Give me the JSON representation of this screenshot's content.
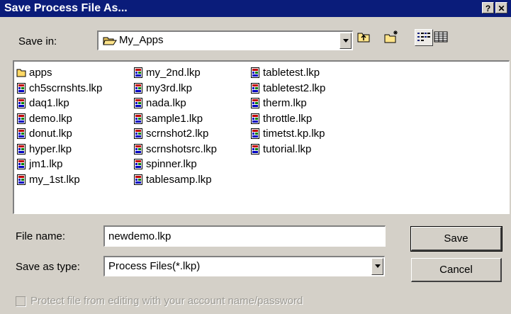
{
  "window": {
    "title": "Save Process File As...",
    "help_button": "?",
    "close_button": "✕"
  },
  "save_in": {
    "label": "Save in:",
    "value": "My_Apps",
    "folder_icon": "open-folder-icon"
  },
  "toolbar": {
    "buttons": [
      {
        "name": "up-one-level-icon"
      },
      {
        "name": "new-folder-icon"
      },
      {
        "name": "list-view-icon"
      },
      {
        "name": "details-view-icon"
      }
    ]
  },
  "files": {
    "columns": [
      [
        {
          "name": "apps",
          "icon": "folder-icon"
        },
        {
          "name": "ch5scrnshts.lkp",
          "icon": "file-icon"
        },
        {
          "name": "daq1.lkp",
          "icon": "file-icon"
        },
        {
          "name": "demo.lkp",
          "icon": "file-icon"
        },
        {
          "name": "donut.lkp",
          "icon": "file-icon"
        },
        {
          "name": "hyper.lkp",
          "icon": "file-icon"
        },
        {
          "name": "jm1.lkp",
          "icon": "file-icon"
        },
        {
          "name": "my_1st.lkp",
          "icon": "file-icon"
        }
      ],
      [
        {
          "name": "my_2nd.lkp",
          "icon": "file-icon"
        },
        {
          "name": "my3rd.lkp",
          "icon": "file-icon"
        },
        {
          "name": "nada.lkp",
          "icon": "file-icon"
        },
        {
          "name": "sample1.lkp",
          "icon": "file-icon"
        },
        {
          "name": "scrnshot2.lkp",
          "icon": "file-icon"
        },
        {
          "name": "scrnshotsrc.lkp",
          "icon": "file-icon"
        },
        {
          "name": "spinner.lkp",
          "icon": "file-icon"
        },
        {
          "name": "tablesamp.lkp",
          "icon": "file-icon"
        }
      ],
      [
        {
          "name": "tabletest.lkp",
          "icon": "file-icon"
        },
        {
          "name": "tabletest2.lkp",
          "icon": "file-icon"
        },
        {
          "name": "therm.lkp",
          "icon": "file-icon"
        },
        {
          "name": "throttle.lkp",
          "icon": "file-icon"
        },
        {
          "name": "timetst.kp.lkp",
          "icon": "file-icon"
        },
        {
          "name": "tutorial.lkp",
          "icon": "file-icon"
        }
      ]
    ]
  },
  "file_name": {
    "label": "File name:",
    "value": "newdemo.lkp"
  },
  "save_as_type": {
    "label": "Save as type:",
    "value": "Process Files(*.lkp)"
  },
  "buttons": {
    "save": "Save",
    "cancel": "Cancel"
  },
  "protect": {
    "label": "Protect file from editing with your account name/password",
    "checked": false,
    "enabled": false
  },
  "colors": {
    "titlebar": "#0a1c7a",
    "face": "#d4d0c8",
    "folder": "#ffd966"
  }
}
